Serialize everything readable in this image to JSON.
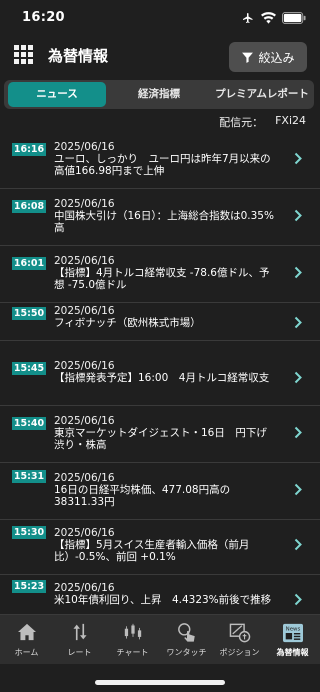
{
  "status_bar": {
    "time": "16:20"
  },
  "header": {
    "title": "為替情報",
    "filter_label": "絞込み"
  },
  "tabs": [
    {
      "label": "ニュース",
      "active": true
    },
    {
      "label": "経済指標",
      "active": false
    },
    {
      "label": "プレミアムレポート",
      "active": false
    }
  ],
  "source": {
    "label": "配信元：",
    "value": "FXi24"
  },
  "news": [
    {
      "time": "16:16",
      "date": "2025/06/16",
      "headline": "ユーロ、しっかり　ユーロ円は昨年7月以来の高値166.98円まで上伸"
    },
    {
      "time": "16:08",
      "date": "2025/06/16",
      "headline": "中国株大引け（16日）：上海総合指数は0.35%高"
    },
    {
      "time": "16:01",
      "date": "2025/06/16",
      "headline": "【指標】4月トルコ経常収支 -78.6億ドル、予想 -75.0億ドル"
    },
    {
      "time": "15:50",
      "date": "2025/06/16",
      "headline": "フィボナッチ（欧州株式市場）"
    },
    {
      "time": "15:45",
      "date": "2025/06/16",
      "headline": "【指標発表予定】16:00　4月トルコ経常収支"
    },
    {
      "time": "15:40",
      "date": "2025/06/16",
      "headline": "東京マーケットダイジェスト・16日　円下げ渋り・株高"
    },
    {
      "time": "15:31",
      "date": "2025/06/16",
      "headline": "16日の日経平均株価、477.08円高の38311.33円"
    },
    {
      "time": "15:30",
      "date": "2025/06/16",
      "headline": "【指標】5月スイス生産者輸入価格（前月比）-0.5%、前回 +0.1%"
    },
    {
      "time": "15:23",
      "date": "2025/06/16",
      "headline": "米10年債利回り、上昇　4.4323%前後で推移"
    }
  ],
  "bottom_nav": [
    {
      "label": "ホーム",
      "icon": "home-icon"
    },
    {
      "label": "レート",
      "icon": "rate-icon"
    },
    {
      "label": "チャート",
      "icon": "candlestick-chart-icon"
    },
    {
      "label": "ワンタッチ",
      "icon": "one-touch-icon"
    },
    {
      "label": "ポジション",
      "icon": "position-icon"
    },
    {
      "label": "為替情報",
      "icon": "news-icon",
      "badge": "News"
    }
  ],
  "colors": {
    "accent": "#138f8a",
    "background": "#1f1f1f",
    "nav": "#2e2e2e"
  }
}
